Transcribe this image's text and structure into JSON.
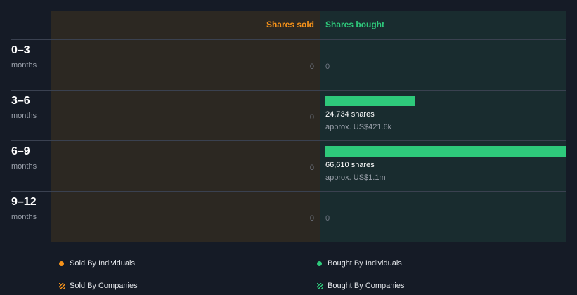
{
  "chart_data": {
    "type": "bar",
    "orientation": "horizontal",
    "header": {
      "sold": "Shares sold",
      "bought": "Shares bought"
    },
    "categories": [
      {
        "range": "0–3",
        "unit": "months"
      },
      {
        "range": "3–6",
        "unit": "months"
      },
      {
        "range": "6–9",
        "unit": "months"
      },
      {
        "range": "9–12",
        "unit": "months"
      }
    ],
    "series": [
      {
        "name": "Shares sold",
        "values": [
          0,
          0,
          0,
          0
        ]
      },
      {
        "name": "Shares bought",
        "values": [
          0,
          24734,
          66610,
          0
        ]
      }
    ],
    "bought_labels": [
      {
        "shares": "0",
        "approx": ""
      },
      {
        "shares": "24,734 shares",
        "approx": "approx. US$421.6k"
      },
      {
        "shares": "66,610 shares",
        "approx": "approx. US$1.1m"
      },
      {
        "shares": "0",
        "approx": ""
      }
    ],
    "sold_labels": [
      "0",
      "0",
      "0",
      "0"
    ],
    "colors": {
      "background": "#151b26",
      "sold_panel": "#2c2822",
      "bought_panel": "#192c2f",
      "sold": "#f7931a",
      "bought": "#2ec97b"
    }
  },
  "legend": {
    "sold_individuals": "Sold By Individuals",
    "bought_individuals": "Bought By Individuals",
    "sold_companies": "Sold By Companies",
    "bought_companies": "Bought By Companies"
  }
}
